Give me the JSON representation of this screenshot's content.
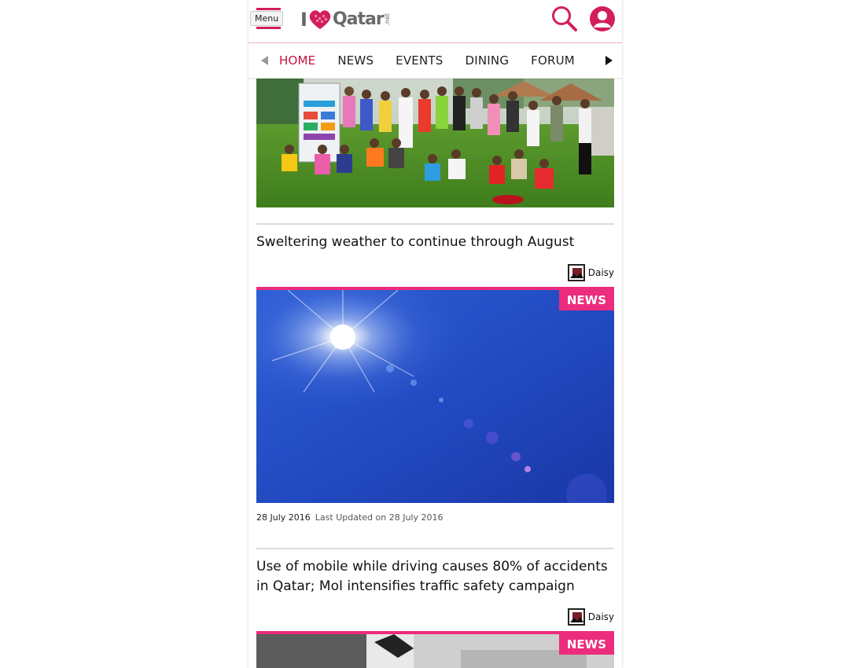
{
  "header": {
    "menu_label": "Menu",
    "logo": {
      "prefix": "I",
      "word": "Qatar",
      "suffix": ".net"
    },
    "colors": {
      "brand": "#d21e5c",
      "logo_gray": "#6a6a6a"
    }
  },
  "nav": {
    "tabs": [
      {
        "label": "HOME",
        "active": true
      },
      {
        "label": "NEWS",
        "active": false
      },
      {
        "label": "EVENTS",
        "active": false
      },
      {
        "label": "DINING",
        "active": false
      },
      {
        "label": "FORUM",
        "active": false
      }
    ],
    "icons": {
      "prev": "arrow-left-icon",
      "next": "arrow-right-icon"
    }
  },
  "articles": [
    {
      "title": "Sweltering weather to continue through August",
      "author": "Daisy",
      "category": "NEWS",
      "date": "28 July 2016",
      "updated": "Last Updated on 28 July 2016"
    },
    {
      "title": "Use of mobile while driving causes 80% of accidents in Qatar; MoI intensifies traffic safety campaign",
      "author": "Daisy",
      "category": "NEWS"
    }
  ],
  "colors": {
    "accent": "#ec2c7c",
    "active_tab": "#c8123e"
  }
}
